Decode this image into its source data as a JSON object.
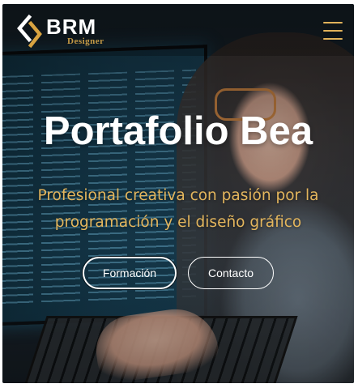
{
  "header": {
    "logo_text": "BRM",
    "logo_subtitle": "Designer",
    "menu_icon": "hamburger-menu-icon"
  },
  "hero": {
    "title": "Portafolio Bea",
    "subtitle": "Profesional creativa con pasión por la programación y el diseño gráfico",
    "buttons": [
      {
        "label": "Formación"
      },
      {
        "label": "Contacto"
      }
    ]
  },
  "colors": {
    "accent_gold": "#e1b25a",
    "logo_gold": "#c59a45",
    "text_white": "#ffffff"
  }
}
